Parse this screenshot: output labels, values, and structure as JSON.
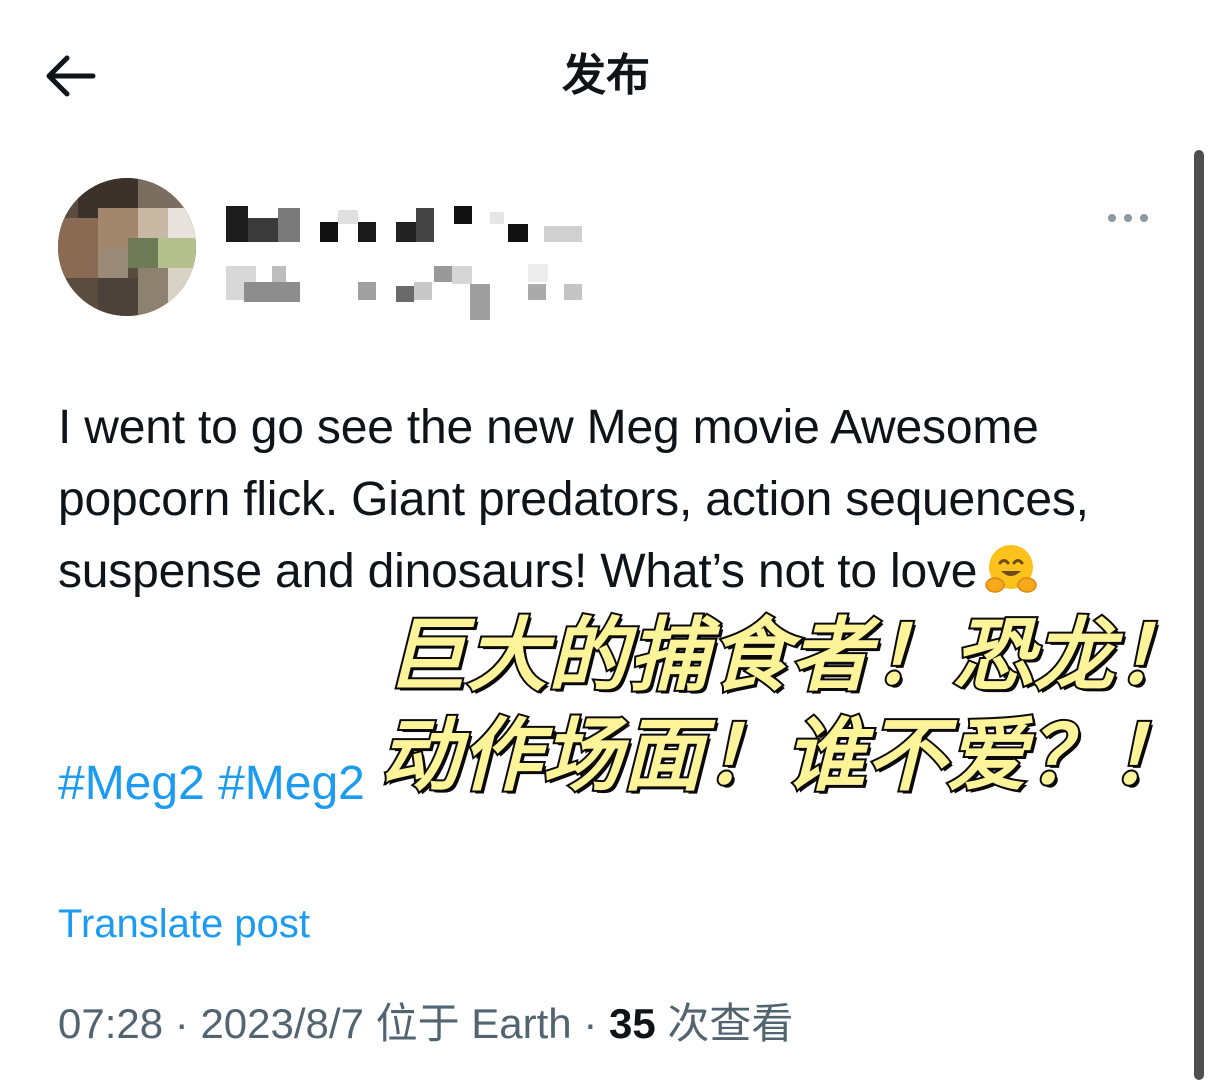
{
  "header": {
    "back_icon": "arrow-left-icon",
    "title": "发布"
  },
  "author": {
    "avatar": "pixelated-avatar",
    "name_obscured": true,
    "more_icon": "more-horizontal-icon"
  },
  "post": {
    "text": "I went to go see the new Meg movie Awesome popcorn flick. Giant predators, action sequences, suspense and dinosaurs! What’s not to love",
    "emoji": "hugging-face-emoji",
    "hashtags": [
      "#Meg2",
      "#Meg2"
    ],
    "translate_label": "Translate post"
  },
  "meta": {
    "time": "07:28",
    "sep1": " · ",
    "date": "2023/8/7",
    "location": " 位于 Earth",
    "sep2": " · ",
    "views": "35",
    "views_label": " 次查看"
  },
  "overlay": {
    "line1": "巨大的捕食者！恐龙！",
    "line2": "动作场面！谁不爱？！"
  },
  "colors": {
    "link": "#1d9bf0",
    "meta": "#536471",
    "overlay_fill": "#fdf49a",
    "overlay_stroke": "#0a0a0a"
  }
}
